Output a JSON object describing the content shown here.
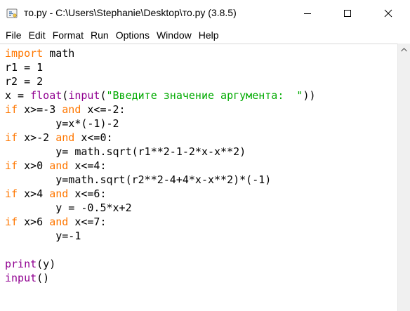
{
  "window": {
    "title": "то.py - C:\\Users\\Stephanie\\Desktop\\то.py (3.8.5)"
  },
  "menu": {
    "items": [
      "File",
      "Edit",
      "Format",
      "Run",
      "Options",
      "Window",
      "Help"
    ]
  },
  "editor": {
    "lines": [
      [
        {
          "t": "kw",
          "v": "import"
        },
        {
          "t": "",
          "v": " math"
        }
      ],
      [
        {
          "t": "",
          "v": "r1 = 1"
        }
      ],
      [
        {
          "t": "",
          "v": "r2 = 2"
        }
      ],
      [
        {
          "t": "",
          "v": "x = "
        },
        {
          "t": "bi",
          "v": "float"
        },
        {
          "t": "",
          "v": "("
        },
        {
          "t": "bi",
          "v": "input"
        },
        {
          "t": "",
          "v": "("
        },
        {
          "t": "str",
          "v": "\"Введите значение аргумента:  \""
        },
        {
          "t": "",
          "v": "))"
        }
      ],
      [
        {
          "t": "kw",
          "v": "if"
        },
        {
          "t": "",
          "v": " x>=-3 "
        },
        {
          "t": "kw",
          "v": "and"
        },
        {
          "t": "",
          "v": " x<=-2:"
        }
      ],
      [
        {
          "t": "",
          "v": "        y=x*(-1)-2"
        }
      ],
      [
        {
          "t": "kw",
          "v": "if"
        },
        {
          "t": "",
          "v": " x>-2 "
        },
        {
          "t": "kw",
          "v": "and"
        },
        {
          "t": "",
          "v": " x<=0:"
        }
      ],
      [
        {
          "t": "",
          "v": "        y= math.sqrt(r1**2-1-2*x-x**2)"
        }
      ],
      [
        {
          "t": "kw",
          "v": "if"
        },
        {
          "t": "",
          "v": " x>0 "
        },
        {
          "t": "kw",
          "v": "and"
        },
        {
          "t": "",
          "v": " x<=4:"
        }
      ],
      [
        {
          "t": "",
          "v": "        y=math.sqrt(r2**2-4+4*x-x**2)*(-1)"
        }
      ],
      [
        {
          "t": "kw",
          "v": "if"
        },
        {
          "t": "",
          "v": " x>4 "
        },
        {
          "t": "kw",
          "v": "and"
        },
        {
          "t": "",
          "v": " x<=6:"
        }
      ],
      [
        {
          "t": "",
          "v": "        y = -0.5*x+2"
        }
      ],
      [
        {
          "t": "kw",
          "v": "if"
        },
        {
          "t": "",
          "v": " x>6 "
        },
        {
          "t": "kw",
          "v": "and"
        },
        {
          "t": "",
          "v": " x<=7:"
        }
      ],
      [
        {
          "t": "",
          "v": "        y=-1"
        }
      ],
      [
        {
          "t": "",
          "v": ""
        }
      ],
      [
        {
          "t": "bi",
          "v": "print"
        },
        {
          "t": "",
          "v": "(y)"
        }
      ],
      [
        {
          "t": "bi",
          "v": "input"
        },
        {
          "t": "",
          "v": "()"
        }
      ]
    ]
  },
  "colors": {
    "keyword": "#ff7700",
    "builtin": "#900090",
    "string": "#00aa00",
    "text": "#000000",
    "background": "#ffffff"
  },
  "icons": {
    "app": "python-idle-icon",
    "minimize": "minimize-icon",
    "maximize": "maximize-icon",
    "close": "close-icon",
    "scroll_up": "chevron-up-icon"
  }
}
